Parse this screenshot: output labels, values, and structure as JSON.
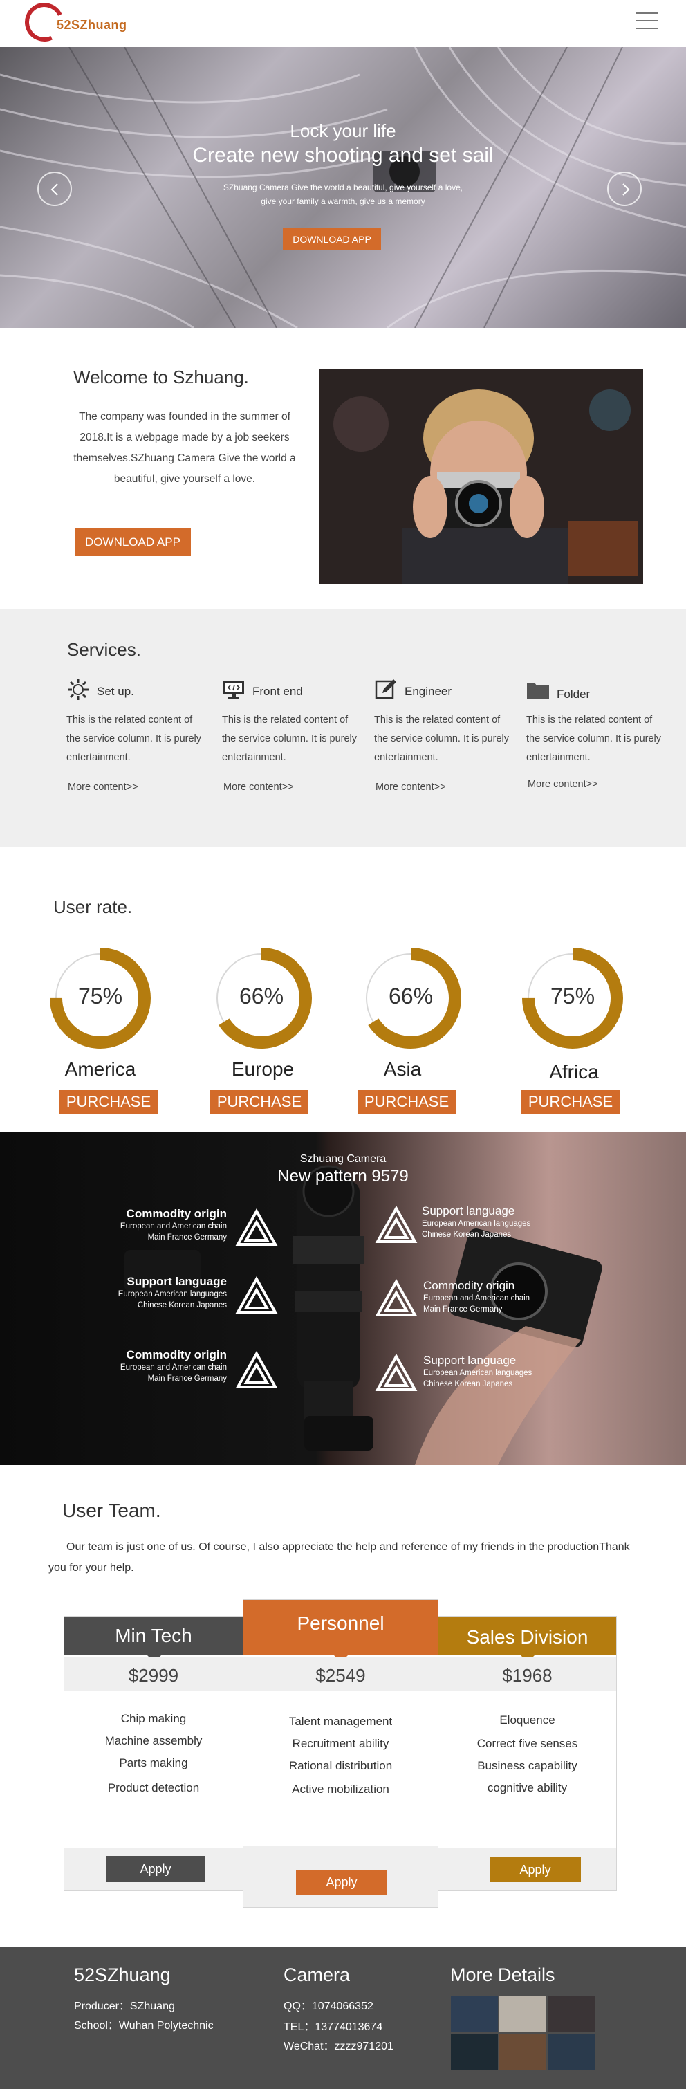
{
  "header": {
    "logo_text": "52SZhuang",
    "menu_icon": "hamburger-menu-icon"
  },
  "hero": {
    "line1": "Lock your life",
    "line2": "Create new shooting and set sail",
    "desc1": "SZhuang Camera Give the world a beautiful, give yourself a love,",
    "desc2": "give your family a warmth, give us a memory",
    "button": "DOWNLOAD APP"
  },
  "welcome": {
    "title": "Welcome to Szhuang.",
    "text": "The company was founded in the summer of 2018.It is a webpage made by a job seekers themselves.SZhuang Camera Give the world a beautiful, give yourself a love.",
    "button": "DOWNLOAD APP"
  },
  "services": {
    "title": "Services.",
    "items": [
      {
        "icon": "gear-icon",
        "name": "Set up.",
        "text": "This is the related content of the service column. It is purely entertainment.",
        "more": "More content>>"
      },
      {
        "icon": "code-monitor-icon",
        "name": "Front end",
        "text": "This is the related content of the service column. It is purely entertainment.",
        "more": "More content>>"
      },
      {
        "icon": "edit-icon",
        "name": "Engineer",
        "text": "This is the related content of the service column. It is purely entertainment.",
        "more": "More content>>"
      },
      {
        "icon": "folder-icon",
        "name": "Folder",
        "text": "This is the related content of the service column. It is purely entertainment.",
        "more": "More content>>"
      }
    ]
  },
  "rate": {
    "title": "User rate.",
    "accent": "#b47c0f",
    "items": [
      {
        "value": 75,
        "label": "75%",
        "region": "America",
        "button": "PURCHASE"
      },
      {
        "value": 66,
        "label": "66%",
        "region": "Europe",
        "button": "PURCHASE"
      },
      {
        "value": 66,
        "label": "66%",
        "region": "Asia",
        "button": "PURCHASE"
      },
      {
        "value": 75,
        "label": "75%",
        "region": "Africa",
        "button": "PURCHASE"
      }
    ]
  },
  "product": {
    "subtitle": "Szhuang Camera",
    "title": "New pattern 9579",
    "left": [
      {
        "h": "Commodity origin",
        "l1": "European and American chain",
        "l2": "Main France Germany"
      },
      {
        "h": "Support language",
        "l1": "European American languages",
        "l2": "Chinese Korean Japanes"
      },
      {
        "h": "Commodity origin",
        "l1": "European and American chain",
        "l2": "Main France Germany"
      }
    ],
    "right": [
      {
        "h": "Support language",
        "l1": "European American languages",
        "l2": "Chinese Korean Japanes"
      },
      {
        "h": "Commodity origin",
        "l1": "European and American chain",
        "l2": "Main France Germany"
      },
      {
        "h": "Support language",
        "l1": "European American languages",
        "l2": "Chinese Korean Japanes"
      }
    ]
  },
  "team": {
    "title": "User Team.",
    "text": "Our team is just one of us. Of course, I also appreciate the help and reference of my friends in the productionThank you for your help.",
    "plans": [
      {
        "name": "Min Tech",
        "price": "$2999",
        "items": [
          "Chip making",
          "Machine assembly",
          "Parts making",
          "Product detection"
        ],
        "button": "Apply",
        "color": "#4d4d4d"
      },
      {
        "name": "Personnel",
        "price": "$2549",
        "items": [
          "Talent management",
          "Recruitment ability",
          "Rational distribution",
          "Active mobilization"
        ],
        "button": "Apply",
        "color": "#d36b2a"
      },
      {
        "name": "Sales Division",
        "price": "$1968",
        "items": [
          "Eloquence",
          "Correct five senses",
          "Business capability",
          "cognitive ability"
        ],
        "button": "Apply",
        "color": "#b47c0f"
      }
    ]
  },
  "footer": {
    "col1": {
      "title": "52SZhuang",
      "l1": "Producer：SZhuang",
      "l2": "School：Wuhan Polytechnic"
    },
    "col2": {
      "title": "Camera",
      "l1": "QQ：1074066352",
      "l2": "TEL：13774013674",
      "l3": "WeChat：zzzz971201"
    },
    "col3": {
      "title": "More Details"
    }
  }
}
